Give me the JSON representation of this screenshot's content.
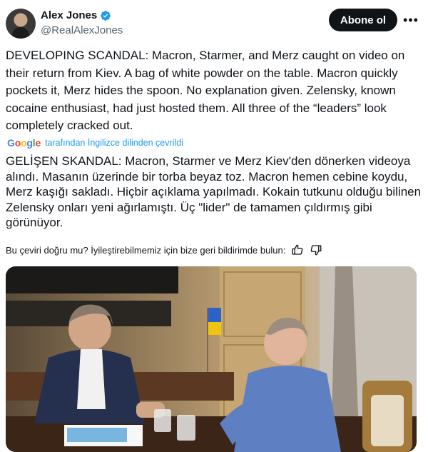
{
  "author": {
    "display_name": "Alex Jones",
    "handle": "@RealAlexJones",
    "verified": true
  },
  "actions": {
    "follow_label": "Abone ol",
    "more_label": "•••"
  },
  "post": {
    "text": "DEVELOPING SCANDAL: Macron, Starmer, and Merz caught on video on their return from Kiev. A bag of white powder on the table. Macron quickly pockets it, Merz hides the spoon. No explanation given. Zelensky, known cocaine enthusiast, had just hosted them. All three of the “leaders” look completely cracked out."
  },
  "translation": {
    "provider": "Google",
    "attribution": "tarafından İngilizce dilinden çevrildi",
    "text": "GELİŞEN SKANDAL: Macron, Starmer ve Merz Kiev'den dönerken videoya alındı. Masanın üzerinde bir torba beyaz toz. Macron hemen cebine koydu, Merz kaşığı sakladı. Hiçbir açıklama yapılmadı. Kokain tutkunu olduğu bilinen Zelensky onları yeni ağırlamıştı. Üç \"lider\" de tamamen çıldırmış gibi görünüyor.",
    "feedback_prompt": "Bu çeviri doğru mu? İyileştirebilmemiz için bize geri bildirimde bulun:"
  },
  "colors": {
    "accent": "#1d9bf0",
    "text": "#0f1419",
    "secondary": "#536471",
    "button_bg": "#0f1419"
  }
}
